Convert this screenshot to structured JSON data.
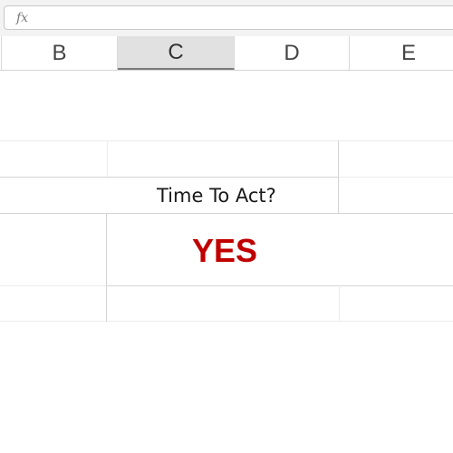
{
  "formula_bar": {
    "fx_symbol": "fx",
    "value": ""
  },
  "columns": {
    "b": "B",
    "c": "C",
    "d": "D",
    "e": "E",
    "selected": "C"
  },
  "cells": {
    "label": "Time To Act?",
    "result": "YES"
  },
  "colors": {
    "result_text": "#c00000",
    "selected_header": "#e1e1e1",
    "gridline": "#d4d4d4"
  }
}
